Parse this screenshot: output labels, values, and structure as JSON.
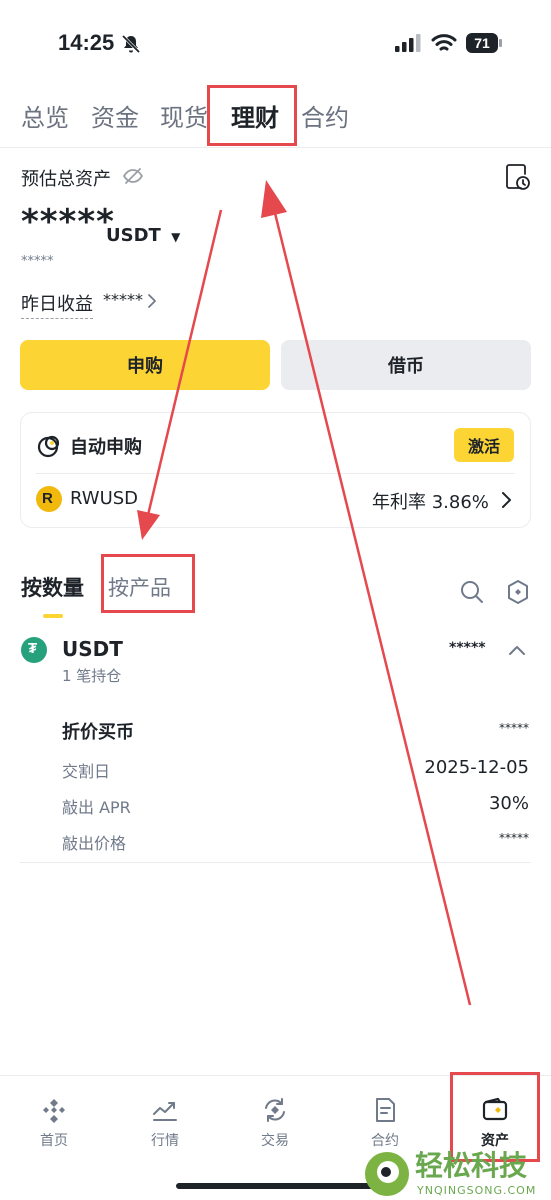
{
  "status_bar": {
    "time": "14:25",
    "battery": "71"
  },
  "tabs": [
    {
      "label": "总览"
    },
    {
      "label": "资金"
    },
    {
      "label": "现货"
    },
    {
      "label": "理财"
    },
    {
      "label": "合约"
    }
  ],
  "summary": {
    "title": "预估总资产",
    "amount": "*****",
    "currency": "USDT",
    "sub_amount": "*****",
    "yesterday_label": "昨日收益",
    "yesterday_value": "*****"
  },
  "actions": {
    "subscribe": "申购",
    "borrow": "借币"
  },
  "auto_subscribe": {
    "title": "自动申购",
    "activate": "激活",
    "asset": "RWUSD",
    "apr_label": "年利率 3.86%"
  },
  "view_tabs": {
    "by_quantity": "按数量",
    "by_product": "按产品"
  },
  "holding": {
    "asset": "USDT",
    "count": "1 笔持仓",
    "value": "*****",
    "product": {
      "title": "折价买币",
      "title_value": "*****",
      "rows": [
        {
          "label": "交割日",
          "value": "2025-12-05"
        },
        {
          "label": "敲出 APR",
          "value": "30%"
        },
        {
          "label": "敲出价格",
          "value": "*****"
        }
      ]
    }
  },
  "bottom_nav": [
    {
      "label": "首页",
      "icon": "home-icon"
    },
    {
      "label": "行情",
      "icon": "markets-icon"
    },
    {
      "label": "交易",
      "icon": "trade-icon"
    },
    {
      "label": "合约",
      "icon": "futures-icon"
    },
    {
      "label": "资产",
      "icon": "wallet-icon"
    }
  ],
  "watermark": {
    "name": "轻松科技",
    "url": "YNQINGSONG.COM"
  },
  "colors": {
    "accent": "#fcd535",
    "annotation": "#e5484d",
    "text": "#1e2329",
    "muted": "#707a8a"
  }
}
